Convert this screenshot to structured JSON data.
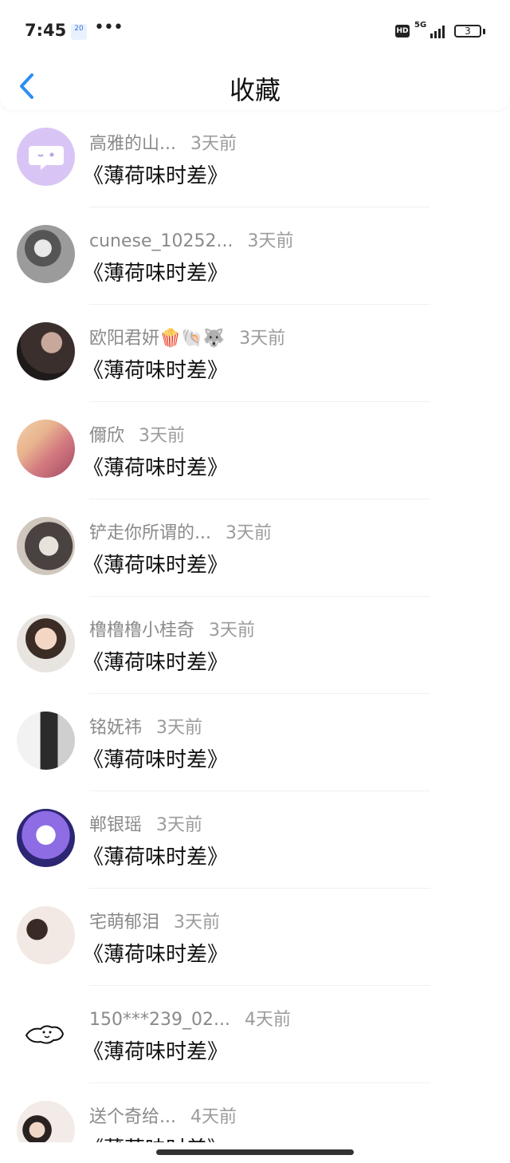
{
  "status_bar": {
    "time": "7:45",
    "badge": "20",
    "dots": "•••",
    "hd": "HD",
    "net": "5G",
    "battery": "3"
  },
  "header": {
    "title": "收藏"
  },
  "items": [
    {
      "name": "高雅的山...",
      "time_ago": "3天前",
      "title": "《薄荷味时差》",
      "avatar": "avatar-icon-purple-chat"
    },
    {
      "name": "cunese_10252...",
      "time_ago": "3天前",
      "title": "《薄荷味时差》",
      "avatar": "avatar-photo"
    },
    {
      "name": "欧阳君妍🍿🐚🐺",
      "time_ago": "3天前",
      "title": "《薄荷味时差》",
      "avatar": "avatar-photo"
    },
    {
      "name": "儞欣",
      "time_ago": "3天前",
      "title": "《薄荷味时差》",
      "avatar": "avatar-photo"
    },
    {
      "name": "铲走你所谓的...",
      "time_ago": "3天前",
      "title": "《薄荷味时差》",
      "avatar": "avatar-photo"
    },
    {
      "name": "橹橹橹小桂奇",
      "time_ago": "3天前",
      "title": "《薄荷味时差》",
      "avatar": "avatar-photo"
    },
    {
      "name": "铭妩祎",
      "time_ago": "3天前",
      "title": "《薄荷味时差》",
      "avatar": "avatar-photo"
    },
    {
      "name": "郸银瑶",
      "time_ago": "3天前",
      "title": "《薄荷味时差》",
      "avatar": "avatar-photo"
    },
    {
      "name": "宅萌郁泪",
      "time_ago": "3天前",
      "title": "《薄荷味时差》",
      "avatar": "avatar-photo"
    },
    {
      "name": "150***239_02...",
      "time_ago": "4天前",
      "title": "《薄荷味时差》",
      "avatar": "avatar-sketch"
    },
    {
      "name": "送个奇给...",
      "time_ago": "4天前",
      "title": "《薄荷味时差》",
      "avatar": "avatar-photo"
    }
  ],
  "colors": {
    "accent": "#2e8ef3",
    "name": "#8a8a8a",
    "title": "#111111"
  }
}
